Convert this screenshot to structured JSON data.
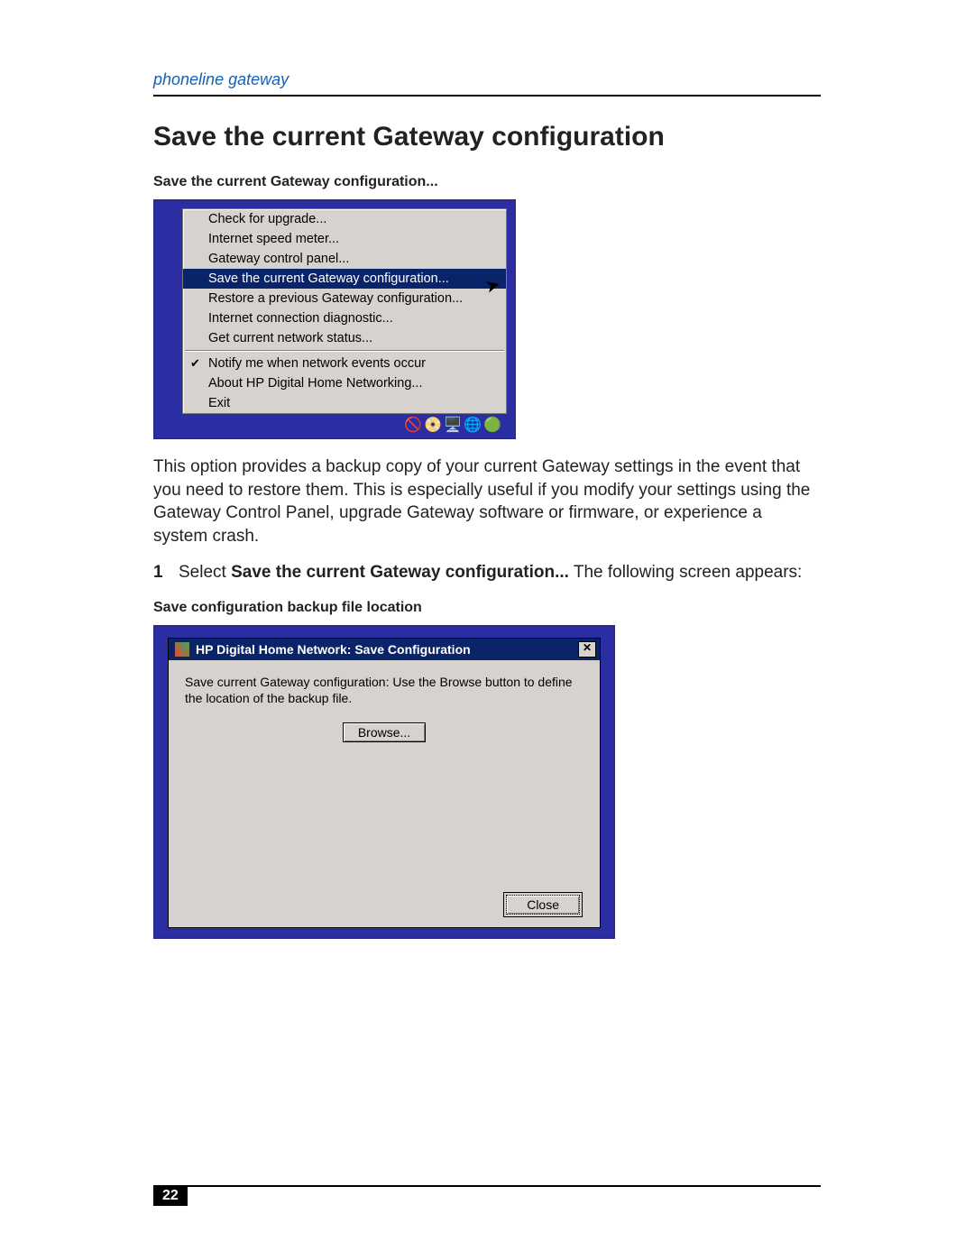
{
  "header": {
    "running_head": "phoneline gateway"
  },
  "section": {
    "title": "Save the current Gateway configuration"
  },
  "figure1": {
    "caption": "Save the current Gateway configuration...",
    "menu": {
      "items": [
        "Check for upgrade...",
        "Internet speed meter...",
        "Gateway control panel...",
        "Save the current Gateway configuration...",
        "Restore a previous Gateway configuration...",
        "Internet connection diagnostic...",
        "Get current network status..."
      ],
      "selected_index": 3,
      "items_group2": [
        "Notify me when network events occur",
        "About HP Digital Home Networking...",
        "Exit"
      ],
      "checked_group2_index": 0
    },
    "tray_icons": "🚫📀🖥️🌐🟢"
  },
  "para1": "This option provides a backup copy of your current Gateway settings in the event that you need to restore them. This is especially useful if you modify your settings using the Gateway Control Panel, upgrade Gateway software or firmware, or experience a system crash.",
  "step1": {
    "num": "1",
    "pre": "Select ",
    "bold": "Save the current Gateway configuration...",
    "post": " The following screen appears:"
  },
  "figure2": {
    "caption": "Save configuration backup file location",
    "title": "HP Digital Home Network: Save Configuration",
    "close_x": "✕",
    "body_text": "Save current Gateway configuration: Use the Browse button to define the location of the backup file.",
    "browse_label": "Browse...",
    "close_label": "Close"
  },
  "footer": {
    "page": "22"
  }
}
